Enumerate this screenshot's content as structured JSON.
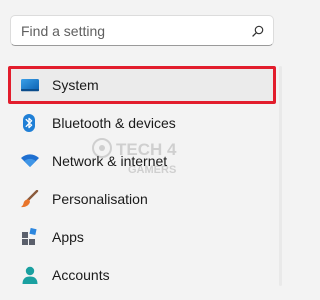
{
  "search": {
    "placeholder": "Find a setting",
    "icon": "search-icon"
  },
  "nav": {
    "items": [
      {
        "label": "System",
        "icon": "system-icon",
        "selected": true
      },
      {
        "label": "Bluetooth & devices",
        "icon": "bluetooth-icon",
        "selected": false
      },
      {
        "label": "Network & internet",
        "icon": "wifi-icon",
        "selected": false
      },
      {
        "label": "Personalisation",
        "icon": "brush-icon",
        "selected": false
      },
      {
        "label": "Apps",
        "icon": "apps-icon",
        "selected": false
      },
      {
        "label": "Accounts",
        "icon": "accounts-icon",
        "selected": false
      }
    ]
  },
  "watermark": {
    "line1": "TECH 4",
    "line2": "GAMERS"
  },
  "colors": {
    "background": "#f3f3f3",
    "selection_outline": "#e21d2c",
    "accent_blue": "#0067c0",
    "teal": "#1aa0a0"
  }
}
